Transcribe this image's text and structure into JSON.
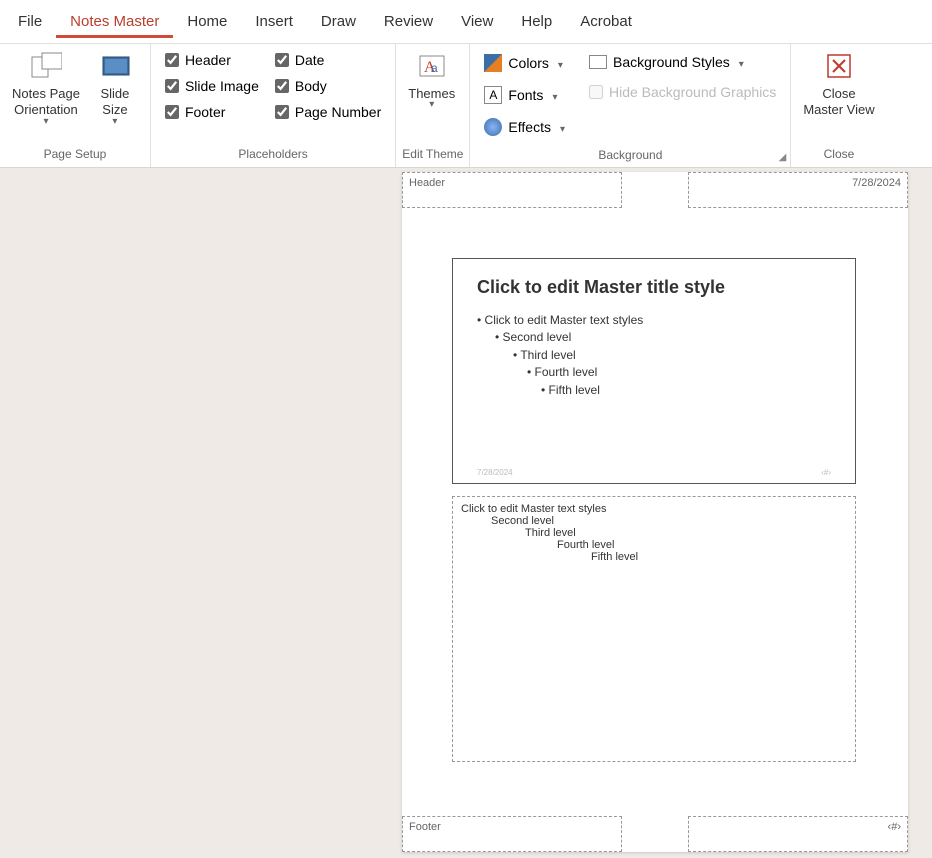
{
  "tabs": {
    "file": "File",
    "notes_master": "Notes Master",
    "home": "Home",
    "insert": "Insert",
    "draw": "Draw",
    "review": "Review",
    "view": "View",
    "help": "Help",
    "acrobat": "Acrobat"
  },
  "page_setup": {
    "orientation": "Notes Page\nOrientation",
    "slide_size": "Slide\nSize",
    "label": "Page Setup"
  },
  "placeholders": {
    "header": "Header",
    "slide_image": "Slide Image",
    "footer": "Footer",
    "date": "Date",
    "body": "Body",
    "page_number": "Page Number",
    "label": "Placeholders"
  },
  "edit_theme": {
    "themes": "Themes",
    "label": "Edit Theme"
  },
  "background": {
    "colors": "Colors",
    "fonts": "Fonts",
    "effects": "Effects",
    "bg_styles": "Background Styles",
    "hide_bg": "Hide Background Graphics",
    "label": "Background"
  },
  "close": {
    "close_master": "Close\nMaster View",
    "label": "Close"
  },
  "canvas": {
    "header_text": "Header",
    "date_text": "7/28/2024",
    "footer_text": "Footer",
    "page_number_text": "‹#›",
    "slide": {
      "title": "Click to edit Master title style",
      "l1": "Click to edit Master text styles",
      "l2": "Second level",
      "l3": "Third level",
      "l4": "Fourth level",
      "l5": "Fifth level",
      "date": "7/28/2024",
      "page": "‹#›"
    },
    "notes": {
      "l1": "Click to edit Master text styles",
      "l2": "Second level",
      "l3": "Third level",
      "l4": "Fourth level",
      "l5": "Fifth level"
    }
  }
}
